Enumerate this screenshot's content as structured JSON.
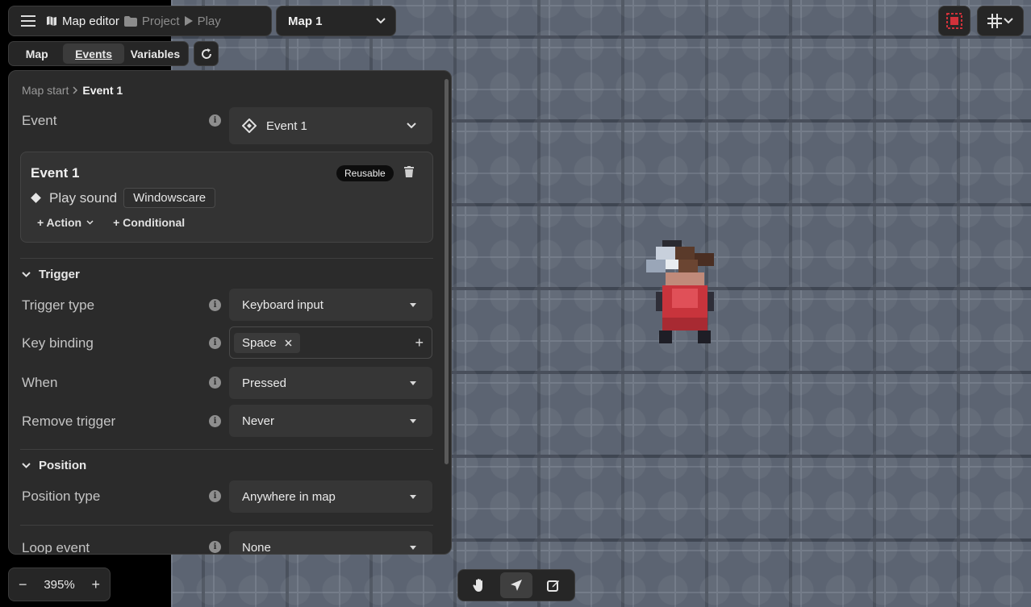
{
  "header": {
    "app_title": "Map editor",
    "breadcrumb_project": "Project",
    "breadcrumb_play": "Play",
    "map_select_value": "Map 1"
  },
  "tabs": [
    {
      "label": "Map",
      "active": false
    },
    {
      "label": "Events",
      "active": true
    },
    {
      "label": "Variables",
      "active": false
    }
  ],
  "panel": {
    "breadcrumb_parent": "Map start",
    "breadcrumb_current": "Event 1",
    "event_label": "Event",
    "event_select_value": "Event 1",
    "card": {
      "title": "Event 1",
      "badge": "Reusable",
      "action_label": "Play sound",
      "action_value": "Windowscare",
      "add_action": "+ Action",
      "add_conditional": "+ Conditional"
    },
    "trigger": {
      "section_title": "Trigger",
      "trigger_type_label": "Trigger type",
      "trigger_type_value": "Keyboard input",
      "key_binding_label": "Key binding",
      "key_binding_value": "Space",
      "when_label": "When",
      "when_value": "Pressed",
      "remove_trigger_label": "Remove trigger",
      "remove_trigger_value": "Never"
    },
    "position": {
      "section_title": "Position",
      "position_type_label": "Position type",
      "position_type_value": "Anywhere in map",
      "loop_event_label": "Loop event",
      "loop_event_value": "None"
    }
  },
  "zoom": {
    "value": "395%",
    "minus": "−",
    "plus": "+"
  },
  "colors": {
    "canvas": "#5c6472",
    "panel": "#2b2b2b",
    "accent_red": "#d0313a"
  },
  "icons": [
    "menu-icon",
    "map-icon",
    "folder-icon",
    "play-icon",
    "chevron-down-icon",
    "refresh-icon",
    "info-icon",
    "diamond-icon",
    "trash-icon",
    "close-icon",
    "plus-icon",
    "hand-icon",
    "navigate-icon",
    "edit-icon",
    "grid-icon",
    "select-frame-icon"
  ]
}
